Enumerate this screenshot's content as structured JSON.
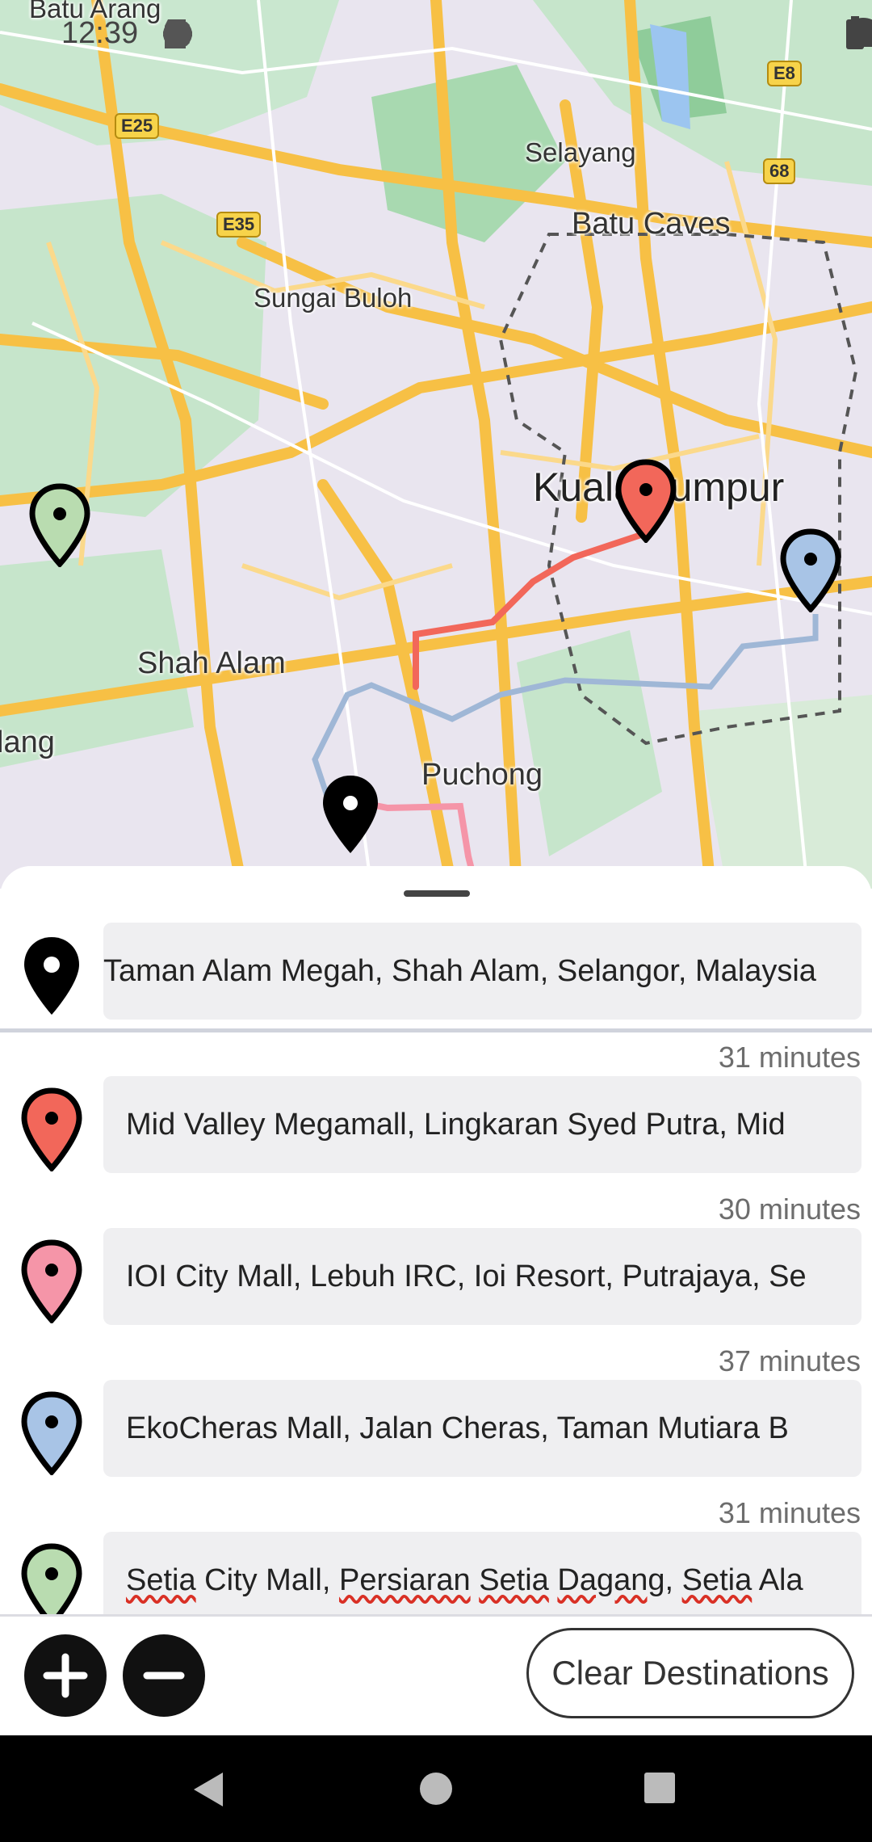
{
  "status_bar": {
    "time": "12:39"
  },
  "map": {
    "labels": {
      "batu_arang": "Batu Arang",
      "selayang": "Selayang",
      "batu_caves": "Batu Caves",
      "sungai_buloh": "Sungai Buloh",
      "kuala_lumpur": "Kuala Lumpur",
      "shah_alam": "Shah Alam",
      "klang": "lang",
      "puchong": "Puchong"
    },
    "shields": {
      "e25": "E25",
      "e35": "E35",
      "e8": "E8",
      "r68": "68"
    }
  },
  "destinations": {
    "origin": {
      "text": "Taman Alam Megah, Shah Alam, Selangor, Malaysia",
      "pin_color": "#000000"
    },
    "stops": [
      {
        "duration": "31 minutes",
        "text": "Mid Valley Megamall, Lingkaran Syed Putra, Mid",
        "pin_color": "#f2675a"
      },
      {
        "duration": "30 minutes",
        "text": "IOI City Mall, Lebuh IRC, Ioi Resort, Putrajaya, Se",
        "pin_color": "#f595a8"
      },
      {
        "duration": "37 minutes",
        "text": "EkoCheras Mall, Jalan Cheras, Taman Mutiara B",
        "pin_color": "#a8c4e6"
      },
      {
        "duration": "31 minutes",
        "text_parts": [
          "Setia",
          " City Mall, ",
          "Persiaran",
          " ",
          "Setia",
          " ",
          "Dagang",
          ", ",
          "Setia",
          " Ala"
        ],
        "pin_color": "#b9dcb0"
      }
    ]
  },
  "actions": {
    "clear_label": "Clear Destinations"
  }
}
